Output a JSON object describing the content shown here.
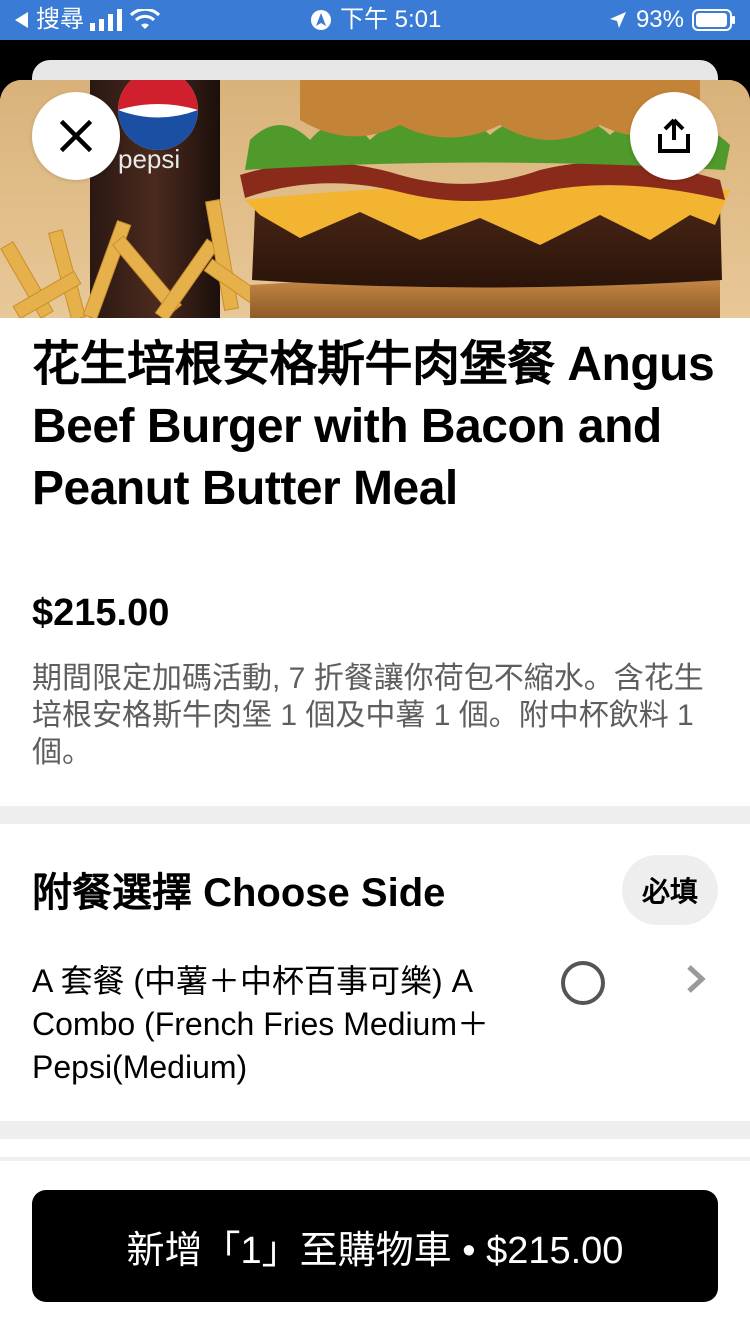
{
  "status_bar": {
    "back_app": "搜尋",
    "time": "下午 5:01",
    "battery": "93%",
    "bar_color": "#3a7bd5"
  },
  "item": {
    "title": "花生培根安格斯牛肉堡餐 Angus Beef Burger with Bacon and Peanut Butter Meal",
    "price": "$215.00",
    "description": "期間限定加碼活動, 7 折餐讓你荷包不縮水。含花生培根安格斯牛肉堡 1 個及中薯 1 個。附中杯飲料 1 個。",
    "hero_brand_text": "pepsi"
  },
  "side_section": {
    "title": "附餐選擇 Choose Side",
    "required_label": "必填",
    "options": [
      {
        "label": "A 套餐 (中薯＋中杯百事可樂) A Combo (French Fries Medium＋Pepsi(Medium)",
        "selected": false
      }
    ]
  },
  "cart_button": {
    "label": "新增「1」至購物車 • $215.00"
  },
  "icons": {
    "close": "close-icon",
    "share": "share-icon",
    "radio": "radio-icon",
    "chevron": "chevron-right-icon"
  }
}
